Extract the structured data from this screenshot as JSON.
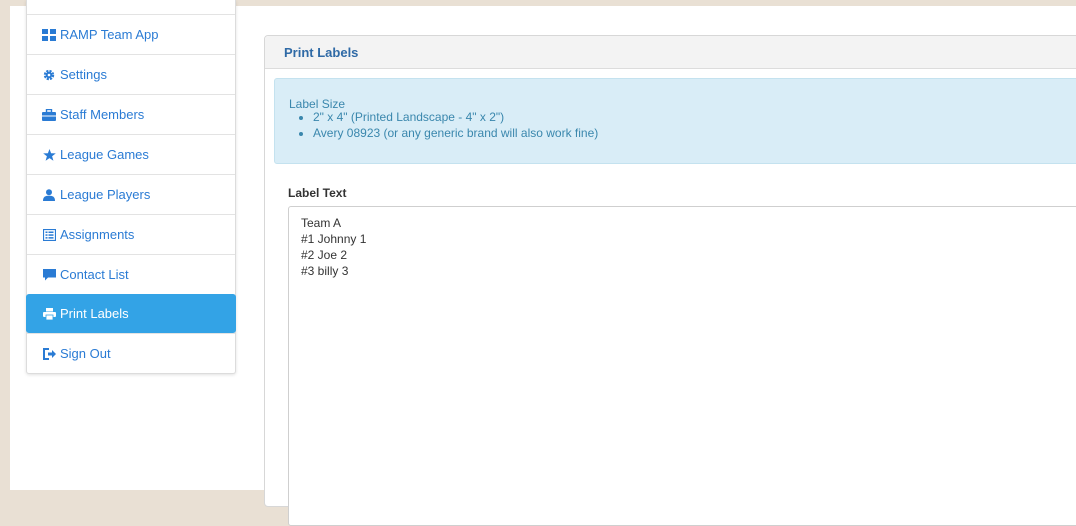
{
  "sidebar": {
    "items": [
      {
        "label": "RAMP Team App",
        "icon": "dashboard-icon"
      },
      {
        "label": "Settings",
        "icon": "gear-icon"
      },
      {
        "label": "Staff Members",
        "icon": "briefcase-icon"
      },
      {
        "label": "League Games",
        "icon": "star-icon"
      },
      {
        "label": "League Players",
        "icon": "user-icon"
      },
      {
        "label": "Assignments",
        "icon": "list-alt-icon"
      },
      {
        "label": "Contact List",
        "icon": "comment-icon"
      },
      {
        "label": "Print Labels",
        "icon": "print-icon",
        "active": true
      },
      {
        "label": "Sign Out",
        "icon": "sign-out-icon"
      }
    ]
  },
  "panel": {
    "title": "Print Labels",
    "info": {
      "title": "Label Size",
      "bullets": [
        "2\" x 4\" (Printed Landscape - 4\" x 2\")",
        "Avery 08923 (or any generic brand will also work fine)"
      ]
    },
    "label_text_heading": "Label Text",
    "label_text_value": "Team A\n#1 Johnny 1\n#2 Joe 2\n#3 billy 3"
  },
  "colors": {
    "link": "#2a7bd4",
    "active_bg": "#33a3e6",
    "info_bg": "#d9edf7",
    "info_text": "#3a87ad"
  }
}
